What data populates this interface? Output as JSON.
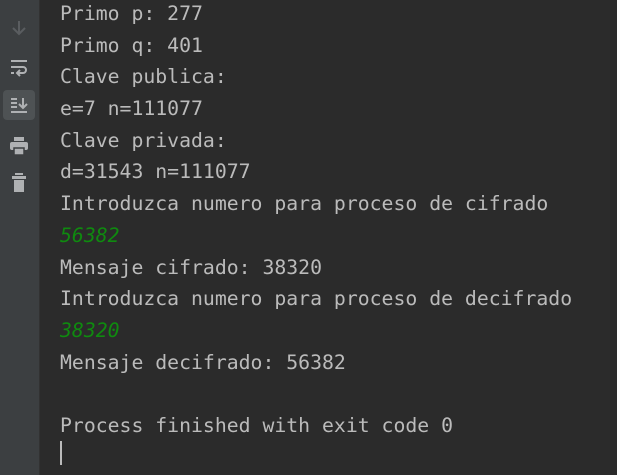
{
  "toolbar": {
    "items": [
      {
        "icon": "arrow-down-icon",
        "label": "Down"
      },
      {
        "icon": "soft-wrap-icon",
        "label": "Soft-Wrap"
      },
      {
        "icon": "scroll-to-end-icon",
        "label": "Scroll to the end",
        "active": true
      },
      {
        "icon": "print-icon",
        "label": "Print"
      },
      {
        "icon": "trash-icon",
        "label": "Clear All"
      }
    ]
  },
  "console": {
    "lines": [
      {
        "text": "Primo p: 277",
        "type": "output"
      },
      {
        "text": "Primo q: 401",
        "type": "output"
      },
      {
        "text": "Clave publica:",
        "type": "output"
      },
      {
        "text": "e=7 n=111077",
        "type": "output"
      },
      {
        "text": "Clave privada:",
        "type": "output"
      },
      {
        "text": "d=31543 n=111077",
        "type": "output"
      },
      {
        "text": "Introduzca numero para proceso de cifrado",
        "type": "output"
      },
      {
        "text": "56382",
        "type": "input"
      },
      {
        "text": "Mensaje cifrado: 38320",
        "type": "output"
      },
      {
        "text": "Introduzca numero para proceso de decifrado",
        "type": "output"
      },
      {
        "text": "38320",
        "type": "input"
      },
      {
        "text": "Mensaje decifrado: 56382",
        "type": "output"
      },
      {
        "text": "",
        "type": "output"
      },
      {
        "text": "Process finished with exit code 0",
        "type": "output"
      }
    ]
  },
  "colors": {
    "background": "#2b2b2b",
    "sidebar": "#3c3f41",
    "text": "#bbbbbb",
    "input": "#0f8a0f"
  }
}
